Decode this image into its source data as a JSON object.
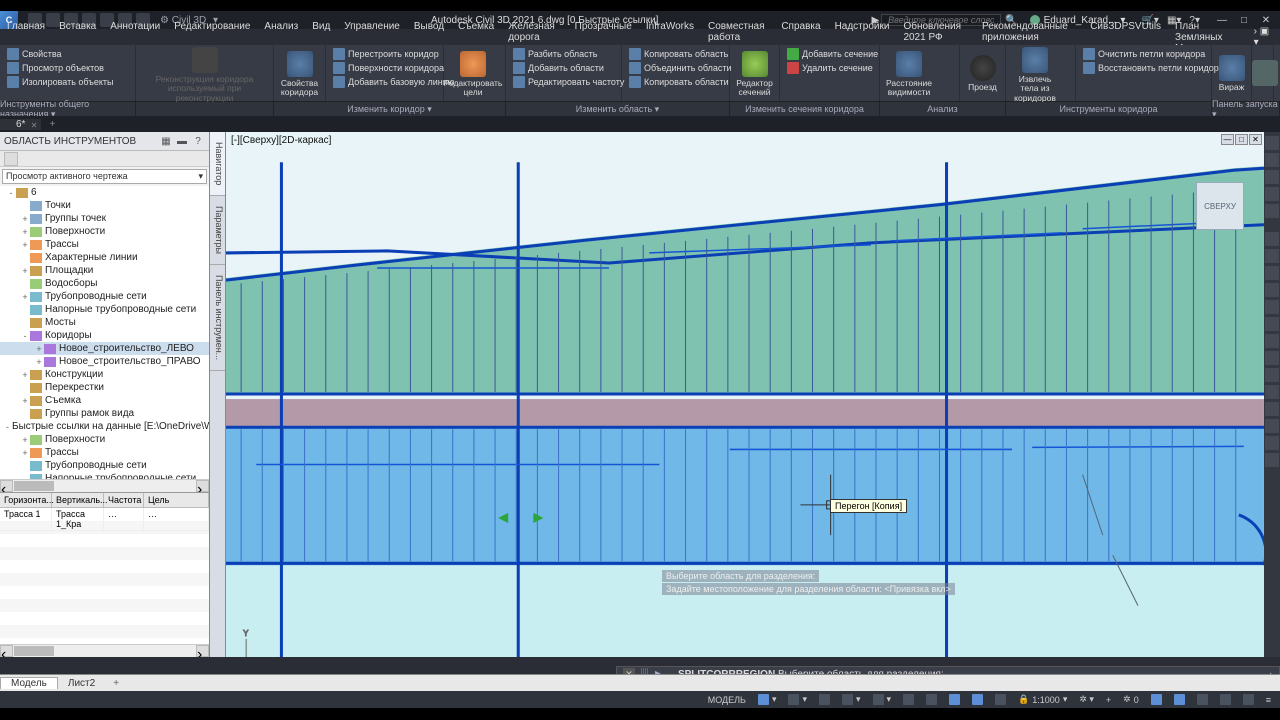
{
  "title": {
    "product": "Civil 3D",
    "file": "Autodesk Civil 3D 2021  6.dwg [0.Быстрые ссылки]"
  },
  "search_placeholder": "Введите ключевое слово/фразу",
  "user": "Eduard_Karad...",
  "menu": [
    "Главная",
    "Вставка",
    "Аннотации",
    "Редактирование",
    "Анализ",
    "Вид",
    "Управление",
    "Вывод",
    "Съемка",
    "Железная дорога",
    "Прозрачные",
    "InfraWorks",
    "Совместная работа",
    "Справка",
    "Надстройки",
    "Обновления 2021 РФ",
    "Рекомендованные приложения",
    "CивЗDPSVUtils",
    "План Земляных Масс"
  ],
  "ribbon_items": {
    "props": {
      "p1": "Свойства",
      "p2": "Просмотр объектов",
      "p3": "Изолировать объекты"
    },
    "reconstruct": {
      "main": "Реконструкция коридора",
      "sub": "используемый при реконструкции"
    },
    "corrprops": "Свойства коридора",
    "rebuild": {
      "a": "Перестроить коридор",
      "b": "Поверхности коридора",
      "c": "Добавить базовую линию"
    },
    "edittargets": "Редактировать цели",
    "split": {
      "a": "Разбить область",
      "b": "Добавить области",
      "c": "Редактировать частоту"
    },
    "copy": {
      "a": "Копировать область",
      "b": "Объединить области",
      "c": "Копировать области"
    },
    "sectioneditor": "Редактор сечений",
    "section2": {
      "a": "Добавить сечение",
      "b": "Удалить сечение"
    },
    "visdist": "Расстояние видимости",
    "drive": "Проезд",
    "bodies": "Извлечь тела из коридоров",
    "clear": "Очистить петли коридора",
    "restore": "Восстановить петли коридора",
    "superelev": "Вираж"
  },
  "ribbon_labels": {
    "tools": "Инструменты общего назначения ▾",
    "edit": "Изменить коридор ▾",
    "region": "Изменить область ▾",
    "sections": "Изменить сечения коридора",
    "analysis": "Анализ",
    "corrtools": "Инструменты коридора",
    "launch": "Панель запуска ▾"
  },
  "file_tab": "6*",
  "toolspace": {
    "title": "ОБЛАСТЬ ИНСТРУМЕНТОВ",
    "filter": "Просмотр активного чертежа",
    "sidetabs": [
      "Навигатор",
      "Параметры",
      "Панель инструмен..."
    ],
    "tree": [
      {
        "d": 0,
        "exp": "-",
        "ico": "",
        "t": "6"
      },
      {
        "d": 1,
        "exp": "",
        "ico": "pt",
        "t": "Точки"
      },
      {
        "d": 1,
        "exp": "+",
        "ico": "pt",
        "t": "Группы точек"
      },
      {
        "d": 1,
        "exp": "+",
        "ico": "surf",
        "t": "Поверхности"
      },
      {
        "d": 1,
        "exp": "+",
        "ico": "align",
        "t": "Трассы"
      },
      {
        "d": 1,
        "exp": "",
        "ico": "align",
        "t": "Характерные линии"
      },
      {
        "d": 1,
        "exp": "+",
        "ico": "",
        "t": "Площадки"
      },
      {
        "d": 1,
        "exp": "",
        "ico": "surf",
        "t": "Водосборы"
      },
      {
        "d": 1,
        "exp": "+",
        "ico": "pipe",
        "t": "Трубопроводные сети"
      },
      {
        "d": 1,
        "exp": "",
        "ico": "pipe",
        "t": "Напорные трубопроводные сети"
      },
      {
        "d": 1,
        "exp": "",
        "ico": "",
        "t": "Мосты"
      },
      {
        "d": 1,
        "exp": "-",
        "ico": "corr",
        "t": "Коридоры"
      },
      {
        "d": 2,
        "exp": "+",
        "ico": "corr",
        "t": "Новое_строительство_ЛЕВО",
        "sel": true
      },
      {
        "d": 2,
        "exp": "+",
        "ico": "corr",
        "t": "Новое_строительство_ПРАВО"
      },
      {
        "d": 1,
        "exp": "+",
        "ico": "",
        "t": "Конструкции"
      },
      {
        "d": 1,
        "exp": "",
        "ico": "",
        "t": "Перекрестки"
      },
      {
        "d": 1,
        "exp": "+",
        "ico": "",
        "t": "Съемка"
      },
      {
        "d": 1,
        "exp": "",
        "ico": "",
        "t": "Группы рамок вида"
      },
      {
        "d": 0,
        "exp": "-",
        "ico": "",
        "t": "Быстрые ссылки на данные [E:\\OneDrive\\W..."
      },
      {
        "d": 1,
        "exp": "+",
        "ico": "surf",
        "t": "Поверхности"
      },
      {
        "d": 1,
        "exp": "+",
        "ico": "align",
        "t": "Трассы"
      },
      {
        "d": 1,
        "exp": "",
        "ico": "pipe",
        "t": "Трубопроводные сети"
      },
      {
        "d": 1,
        "exp": "",
        "ico": "pipe",
        "t": "Напорные трубопроводные сети"
      },
      {
        "d": 1,
        "exp": "+",
        "ico": "corr",
        "t": "Коридоры"
      },
      {
        "d": 1,
        "exp": "",
        "ico": "",
        "t": "Группы рамок вида"
      }
    ]
  },
  "props": {
    "headers": [
      "Горизонта...",
      "Вертикаль...",
      "Частота",
      "Цель"
    ],
    "row": [
      "Трасса 1",
      "Трасса 1_Кра",
      "",
      ""
    ]
  },
  "view_title": "[-][Сверху][2D-каркас]",
  "viewcube": "СВЕРХУ",
  "tooltip": "Перегон [Копия]",
  "cmd_history": [
    "Выберите область для разделения:",
    "Задайте местоположение для разделения области:  <Привязка вкл>"
  ],
  "cmd": {
    "name": "SPLITCORRREGION",
    "prompt": "Выберите область для разделения:"
  },
  "layout_tabs": [
    "Модель",
    "Лист2"
  ],
  "status": {
    "mode": "МОДЕЛЬ",
    "scale": "1:1000",
    "angle": "0"
  }
}
